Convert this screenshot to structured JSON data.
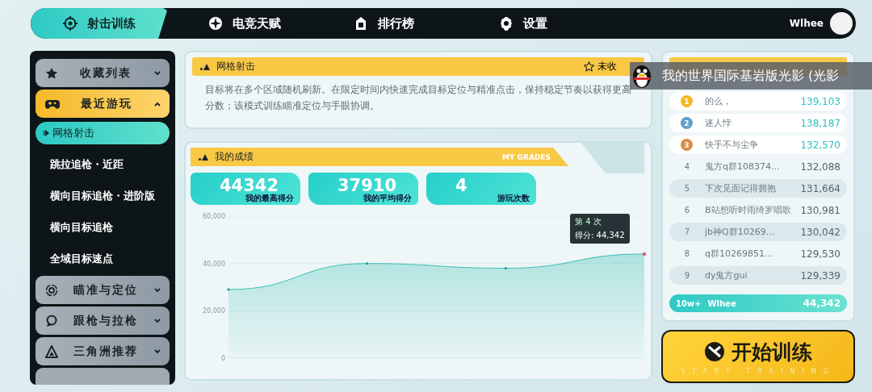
{
  "nav": {
    "tabs": [
      {
        "label": "射击训练",
        "selected": true
      },
      {
        "label": "电竞天赋",
        "selected": false
      },
      {
        "label": "排行榜",
        "selected": false
      },
      {
        "label": "设置",
        "selected": false
      }
    ],
    "user": {
      "name": "Wlhee"
    }
  },
  "sidebar": {
    "groups": [
      {
        "label": "收藏列表",
        "expanded": false
      },
      {
        "label": "最近游玩",
        "expanded": true,
        "children": [
          {
            "label": "网格射击",
            "selected": true
          },
          {
            "label": "跳拉追枪・近距",
            "selected": false
          },
          {
            "label": "横向目标追枪・进阶版",
            "selected": false
          },
          {
            "label": "横向目标追枪",
            "selected": false
          },
          {
            "label": "全域目标速点",
            "selected": false
          }
        ]
      },
      {
        "label": "瞄准与定位",
        "expanded": false
      },
      {
        "label": "跟枪与拉枪",
        "expanded": false
      },
      {
        "label": "三角洲推荐",
        "expanded": false
      }
    ]
  },
  "mode": {
    "title": "网格射击",
    "favorite_label": "未收",
    "favorited": false,
    "description": "目标将在多个区域随机刷新。在限定时间内快速完成目标定位与精准点击，保持稳定节奏以获得更高分数；该模式训练瞄准定位与手眼协调。"
  },
  "grades": {
    "title": "我的成绩",
    "subtitle": "MY GRADES",
    "stats": [
      {
        "value": "44342",
        "label": "我的最高得分"
      },
      {
        "value": "37910",
        "label": "我的平均得分"
      },
      {
        "value": "4",
        "label": "游玩次数"
      }
    ],
    "tooltip": {
      "title": "第 4 次",
      "text": "得分: 44,342"
    },
    "chart_data": {
      "type": "area",
      "series": [
        {
          "color": "#3bbfb3",
          "values": [
            29000,
            40000,
            38000,
            44000
          ]
        }
      ],
      "ylim": [
        0,
        60000
      ],
      "yticks": [
        {
          "value": 0,
          "label": "0"
        },
        {
          "value": 20000,
          "label": "20,000"
        },
        {
          "value": 40000,
          "label": "40,000"
        },
        {
          "value": 60000,
          "label": "60,000"
        }
      ]
    }
  },
  "leaderboard": {
    "rows": [
      {
        "kind": "medal",
        "rank": "1",
        "color": "#f2b821",
        "name": "的么，",
        "score": "139,103"
      },
      {
        "kind": "medal",
        "rank": "2",
        "color": "#5f9fc7",
        "name": "迷人悖",
        "score": "138,187"
      },
      {
        "kind": "medal",
        "rank": "3",
        "color": "#d98c4a",
        "name": "快手不与尘争",
        "score": "132,570"
      },
      {
        "kind": "plain",
        "rank": "4",
        "name": "鬼方q群108374...",
        "score": "132,088"
      },
      {
        "kind": "plain",
        "rank": "5",
        "name": "下次见面记得拥抱",
        "score": "131,664"
      },
      {
        "kind": "plain",
        "rank": "6",
        "name": "B站想听时雨绮罗唱歌",
        "score": "130,981"
      },
      {
        "kind": "plain",
        "rank": "7",
        "name": "jb神Q群10269...",
        "score": "130,042"
      },
      {
        "kind": "plain",
        "rank": "8",
        "name": "q群10269851...",
        "score": "129,530"
      },
      {
        "kind": "plain",
        "rank": "9",
        "name": "dy鬼方gui",
        "score": "129,339"
      }
    ],
    "me": {
      "rank": "10w+",
      "name": "Wlhee",
      "score": "44,342"
    }
  },
  "start_button": {
    "label": "开始训练",
    "subtitle": "START TRAINING"
  },
  "notification": {
    "text": "我的世界国际基岩版光影 (光影"
  }
}
